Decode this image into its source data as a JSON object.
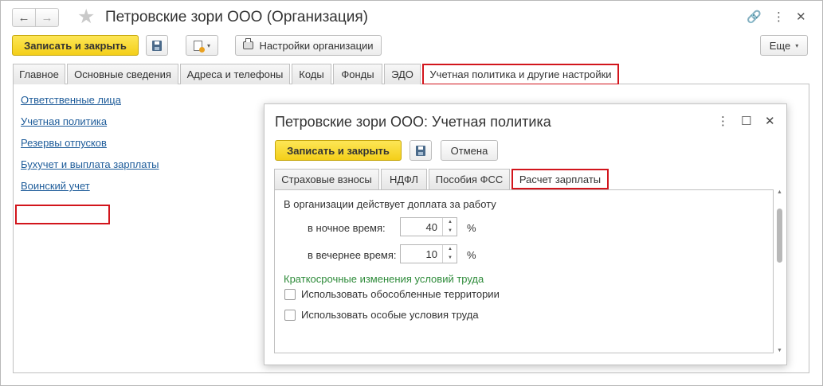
{
  "window": {
    "title": "Петровские зори ООО (Организация)",
    "back_glyph": "←",
    "forward_glyph": "→",
    "star_glyph": "★",
    "link_glyph": "🔗",
    "more_glyph": "⋮",
    "close_glyph": "✕"
  },
  "toolbar": {
    "save_close_label": "Записать и закрыть",
    "settings_label": "Настройки организации",
    "more_label": "Еще",
    "caret": "▾"
  },
  "tabs": [
    {
      "label": "Главное"
    },
    {
      "label": "Основные сведения"
    },
    {
      "label": "Адреса и телефоны"
    },
    {
      "label": "Коды"
    },
    {
      "label": "Фонды"
    },
    {
      "label": "ЭДО"
    },
    {
      "label": "Учетная политика и другие настройки"
    }
  ],
  "links": [
    {
      "label": "Ответственные лица"
    },
    {
      "label": "Учетная политика"
    },
    {
      "label": "Резервы отпусков"
    },
    {
      "label": "Бухучет и выплата зарплаты"
    },
    {
      "label": "Воинский учет"
    }
  ],
  "dialog": {
    "title": "Петровские зори ООО: Учетная политика",
    "more_glyph": "⋮",
    "maximize_glyph": "☐",
    "close_glyph": "✕",
    "save_close_label": "Записать и закрыть",
    "cancel_label": "Отмена",
    "subtabs": [
      {
        "label": "Страховые взносы"
      },
      {
        "label": "НДФЛ"
      },
      {
        "label": "Пособия ФСС"
      },
      {
        "label": "Расчет зарплаты"
      }
    ],
    "content": {
      "heading": "В организации действует доплата за работу",
      "night_label": "в ночное время:",
      "night_value": "40",
      "evening_label": "в вечернее время:",
      "evening_value": "10",
      "percent": "%",
      "section_title": "Краткосрочные изменения условий труда",
      "checkbox1_label": "Использовать обособленные территории",
      "checkbox2_label": "Использовать особые условия труда",
      "spin_up": "▲",
      "spin_down": "▼"
    },
    "scroll_up": "▲",
    "scroll_down": "▼"
  },
  "colors": {
    "accent_yellow": "#f4cf19",
    "highlight_red": "#d2151c",
    "link_blue": "#1e5c9a",
    "section_green": "#2e8b3a"
  }
}
